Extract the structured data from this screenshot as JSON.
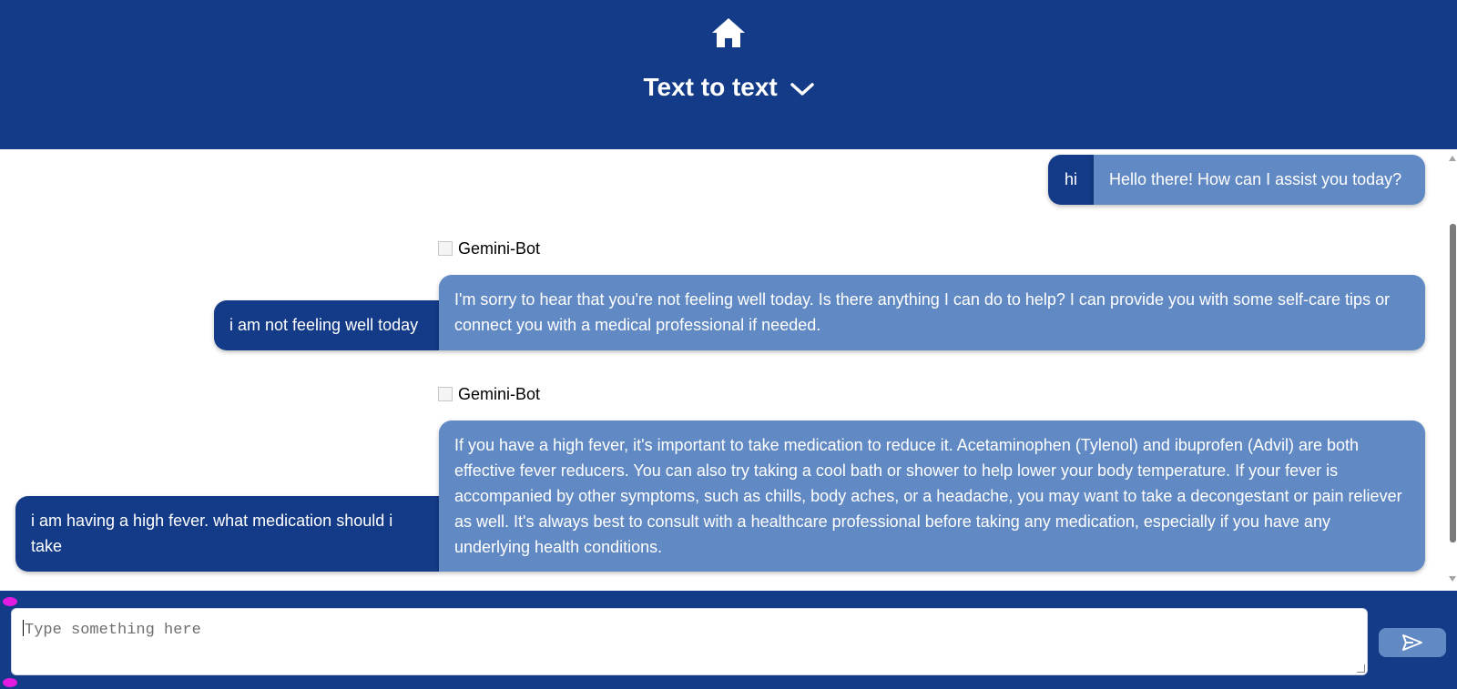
{
  "header": {
    "title": "Text to text",
    "icons": {
      "home": "home-icon",
      "mode_menu": "chevron-down-icon"
    }
  },
  "messages": [
    {
      "role": "user",
      "text": "hi"
    },
    {
      "role": "bot",
      "text": "Hello there! How can I assist you today?"
    },
    {
      "role": "bot_label",
      "text": "Gemini-Bot"
    },
    {
      "role": "user",
      "text": "i am not feeling well today"
    },
    {
      "role": "bot",
      "text": "I'm sorry to hear that you're not feeling well today. Is there anything I can do to help? I can provide you with some self-care tips or connect you with a medical professional if needed."
    },
    {
      "role": "bot_label",
      "text": "Gemini-Bot"
    },
    {
      "role": "user",
      "text": "i am having a high fever. what medication should i take"
    },
    {
      "role": "bot",
      "text": "If you have a high fever, it's important to take medication to reduce it. Acetaminophen (Tylenol) and ibuprofen (Advil) are both effective fever reducers. You can also try taking a cool bath or shower to help lower your body temperature. If your fever is accompanied by other symptoms, such as chills, body aches, or a headache, you may want to take a decongestant or pain reliever as well. It's always best to consult with a healthcare professional before taking any medication, especially if you have any underlying health conditions."
    }
  ],
  "composer": {
    "placeholder": "Type something here",
    "send_icon": "send-icon"
  },
  "colors": {
    "primary": "#143b87",
    "bot_bubble": "#6189c3",
    "user_bubble": "#143b87",
    "background": "#ffffff"
  }
}
